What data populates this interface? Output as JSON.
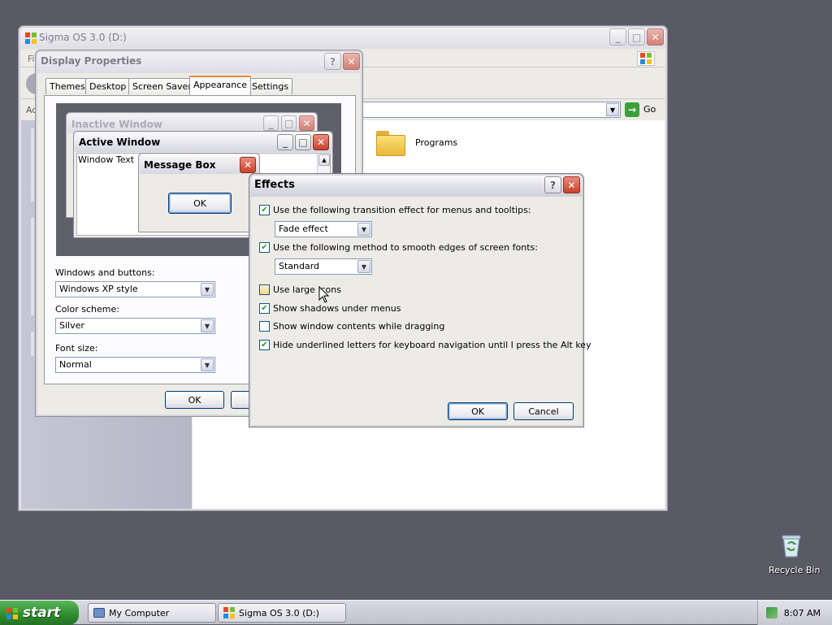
{
  "desktop": {
    "recycle_bin_label": "Recycle Bin"
  },
  "explorer": {
    "title": "Sigma OS 3.0 (D:)",
    "menu_first": "Fi",
    "address_label": "Ad",
    "go_label": "Go",
    "folder_label": "Programs"
  },
  "display_props": {
    "title": "Display Properties",
    "tabs": [
      "Themes",
      "Desktop",
      "Screen Saver",
      "Appearance",
      "Settings"
    ],
    "active_tab": "Appearance",
    "preview": {
      "inactive_title": "Inactive Window",
      "active_title": "Active Window",
      "window_text": "Window Text",
      "message_title": "Message Box",
      "message_ok": "OK"
    },
    "windows_buttons_label": "Windows and buttons:",
    "windows_buttons_value": "Windows XP style",
    "color_scheme_label": "Color scheme:",
    "color_scheme_value": "Silver",
    "font_size_label": "Font size:",
    "font_size_value": "Normal",
    "ok_label": "OK"
  },
  "effects": {
    "title": "Effects",
    "transition_label": "Use the following transition effect for menus and tooltips:",
    "transition_value": "Fade effect",
    "smooth_label": "Use the following method to smooth edges of screen fonts:",
    "smooth_value": "Standard",
    "large_icons_label": "Use large icons",
    "shadows_label": "Show shadows under menus",
    "drag_contents_label": "Show window contents while dragging",
    "hide_underline_label": "Hide underlined letters for keyboard navigation until I press the Alt key",
    "ok_label": "OK",
    "cancel_label": "Cancel",
    "check_mark": "✔"
  },
  "taskbar": {
    "start_label": "start",
    "tasks": [
      "My Computer",
      "Sigma OS 3.0 (D:)"
    ],
    "clock": "8:07 AM"
  }
}
